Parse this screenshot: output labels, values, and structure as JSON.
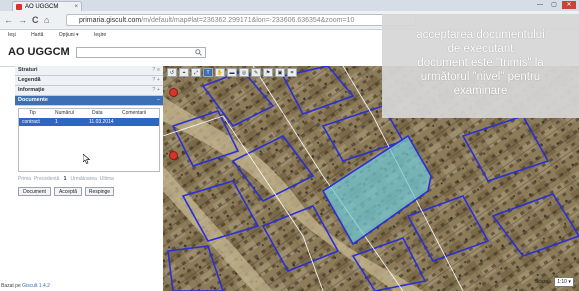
{
  "browser": {
    "tab_title": "AO UGGCM",
    "tab_close": "×",
    "window_controls": [
      "—",
      "▢",
      "✕"
    ],
    "nav_glyphs": [
      "←",
      "→",
      "C",
      "⌂"
    ],
    "url_host": "primaria.giscult.com",
    "url_rest": "/m/default/map#lat=236362.299171&lon=-233606.636354&zoom=10",
    "menu": [
      "Ieşi",
      "Hartă",
      "Opţiuni ▾",
      "Ieşire"
    ]
  },
  "app": {
    "title": "AO UGGCM",
    "search": {
      "value": "",
      "placeholder": ""
    }
  },
  "sidebar": {
    "panels": [
      {
        "label": "Straturi",
        "ctl": "? ≡"
      },
      {
        "label": "Legendă",
        "ctl": "? +"
      },
      {
        "label": "Informaţie",
        "ctl": "? +"
      },
      {
        "label": "Documente",
        "ctl": "−"
      }
    ],
    "doc_columns": [
      "Tip",
      "Numărul",
      "Data",
      "Comentarii"
    ],
    "doc_rows": [
      {
        "tip": "contract",
        "numar": "1",
        "data": "11.03.2014",
        "comentarii": ""
      }
    ],
    "pager": {
      "first": "Prima",
      "prev": "Precedentă",
      "page": "1",
      "next": "Următoarea",
      "last": "Ultima"
    },
    "buttons": [
      "Document",
      "Acceptă",
      "Respinge"
    ],
    "footer_prefix": "Bazat pe",
    "footer_link": "Giscult 1.4.2"
  },
  "map": {
    "tools": [
      "↺",
      "⌖",
      "⤢",
      "T",
      "✋",
      "▬",
      "◎",
      "✎",
      "⚑",
      "▣",
      "⌗"
    ],
    "active_tool_index": 3,
    "overlay_lines": [
      "acceptarea documentului",
      "de executant",
      "document este \"trimis\" la",
      "următorul \"nivel\" pentru",
      "examinare"
    ],
    "scale_label": "Scara :",
    "scale_value": "1:10 ▾",
    "colors": {
      "parcel_outline": "#2a2fd6",
      "highlight_fill": "#6fc9d8",
      "active_blue": "#3d6fb5",
      "pin_red": "#d7352c"
    }
  }
}
